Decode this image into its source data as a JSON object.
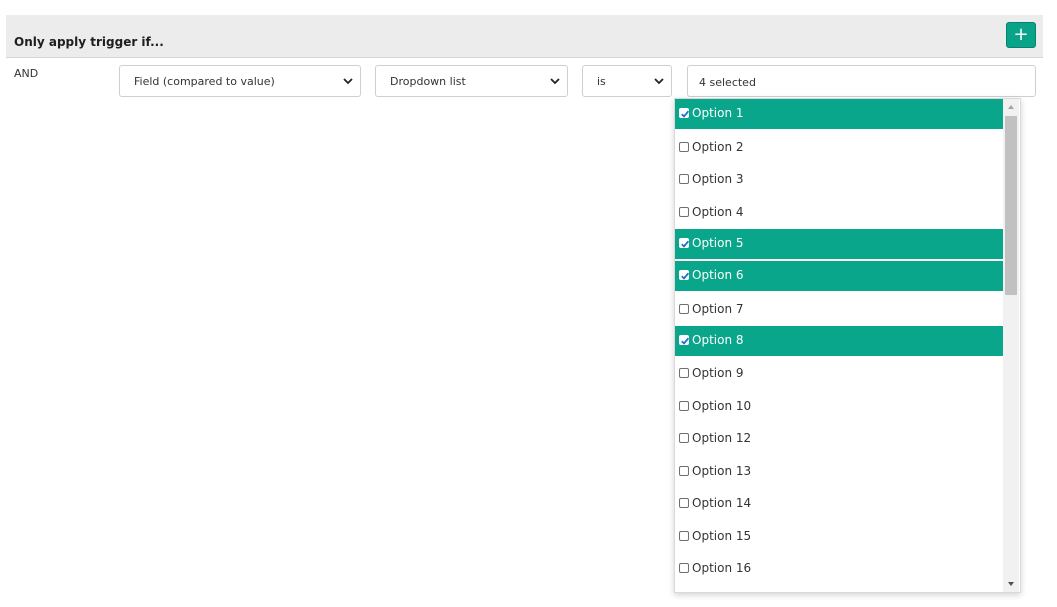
{
  "header": {
    "title": "Only apply trigger if...",
    "add_label": "+"
  },
  "condition": {
    "logic": "AND",
    "field_select": "Field (compared to value)",
    "type_select": "Dropdown list",
    "operator_select": "is",
    "value_select": "4 selected"
  },
  "dropdown": {
    "options": [
      {
        "label": "Option 1",
        "checked": true
      },
      {
        "label": "Option 2",
        "checked": false
      },
      {
        "label": "Option 3",
        "checked": false
      },
      {
        "label": "Option 4",
        "checked": false
      },
      {
        "label": "Option 5",
        "checked": true
      },
      {
        "label": "Option 6",
        "checked": true
      },
      {
        "label": "Option 7",
        "checked": false
      },
      {
        "label": "Option 8",
        "checked": true
      },
      {
        "label": "Option 9",
        "checked": false
      },
      {
        "label": "Option 10",
        "checked": false
      },
      {
        "label": "Option 12",
        "checked": false
      },
      {
        "label": "Option 13",
        "checked": false
      },
      {
        "label": "Option 14",
        "checked": false
      },
      {
        "label": "Option 15",
        "checked": false
      },
      {
        "label": "Option 16",
        "checked": false
      }
    ]
  },
  "colors": {
    "accent": "#0aa68b",
    "header_bg": "#ececec"
  }
}
